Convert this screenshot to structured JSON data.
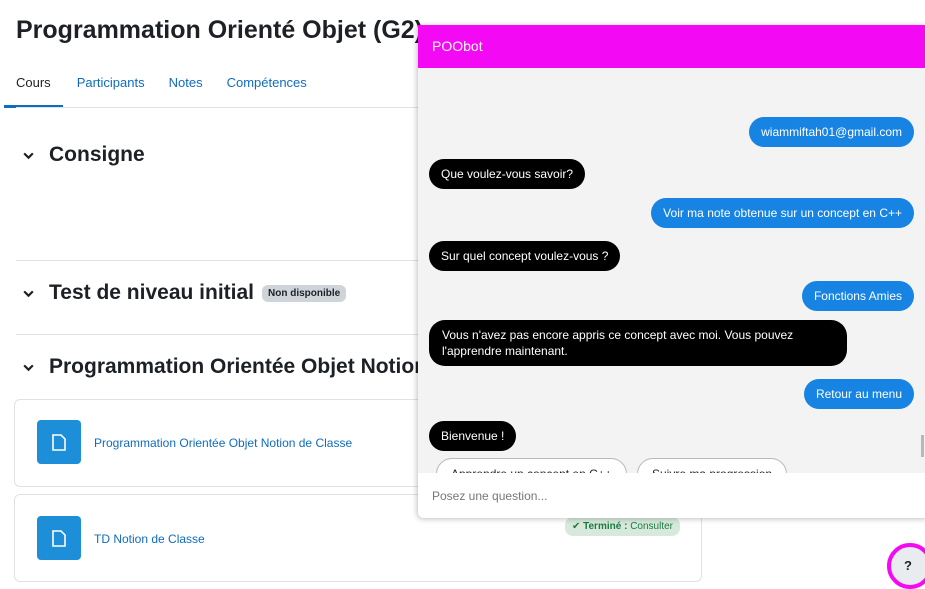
{
  "course": {
    "title": "Programmation Orienté Objet (G2)",
    "tabs": [
      {
        "label": "Cours",
        "active": true
      },
      {
        "label": "Participants"
      },
      {
        "label": "Notes"
      },
      {
        "label": "Compétences"
      }
    ]
  },
  "sections": [
    {
      "title": "Consigne"
    },
    {
      "title": "Test de niveau initial",
      "badge": "Non disponible"
    },
    {
      "title": "Programmation Orientée Objet Notion de Classe"
    }
  ],
  "activities": [
    {
      "label": "Programmation Orientée Objet Notion de Classe",
      "icon": "page-icon"
    },
    {
      "label": "TD Notion de Classe",
      "icon": "page-icon",
      "completion_check": "✔",
      "completion_status": "Terminé :",
      "completion_action": "Consulter"
    }
  ],
  "chat": {
    "title": "POObot",
    "messages": [
      {
        "from": "user",
        "text": "wiammiftah01@gmail.com"
      },
      {
        "from": "bot",
        "text": "Que voulez-vous savoir?"
      },
      {
        "from": "user",
        "text": "Voir ma note obtenue sur un concept en C++"
      },
      {
        "from": "bot",
        "text": "Sur quel concept voulez-vous ?"
      },
      {
        "from": "user",
        "text": "Fonctions Amies"
      },
      {
        "from": "bot",
        "text": "Vous n'avez pas encore appris ce concept avec moi. Vous pouvez l'apprendre maintenant."
      },
      {
        "from": "user",
        "text": "Retour au menu"
      },
      {
        "from": "bot",
        "text": "Bienvenue !"
      }
    ],
    "options": [
      "Apprendre un concept en C++",
      "Suivre ma progression"
    ],
    "input_placeholder": "Posez une question..."
  },
  "help_button": {
    "label": "?"
  },
  "colors": {
    "chat_header": "#f309f3",
    "user_bubble": "#1783e3",
    "bot_bubble": "#000000",
    "link": "#0f6cbf",
    "activity_icon": "#1d8fd8",
    "completion_badge": "#d7e9dc"
  }
}
